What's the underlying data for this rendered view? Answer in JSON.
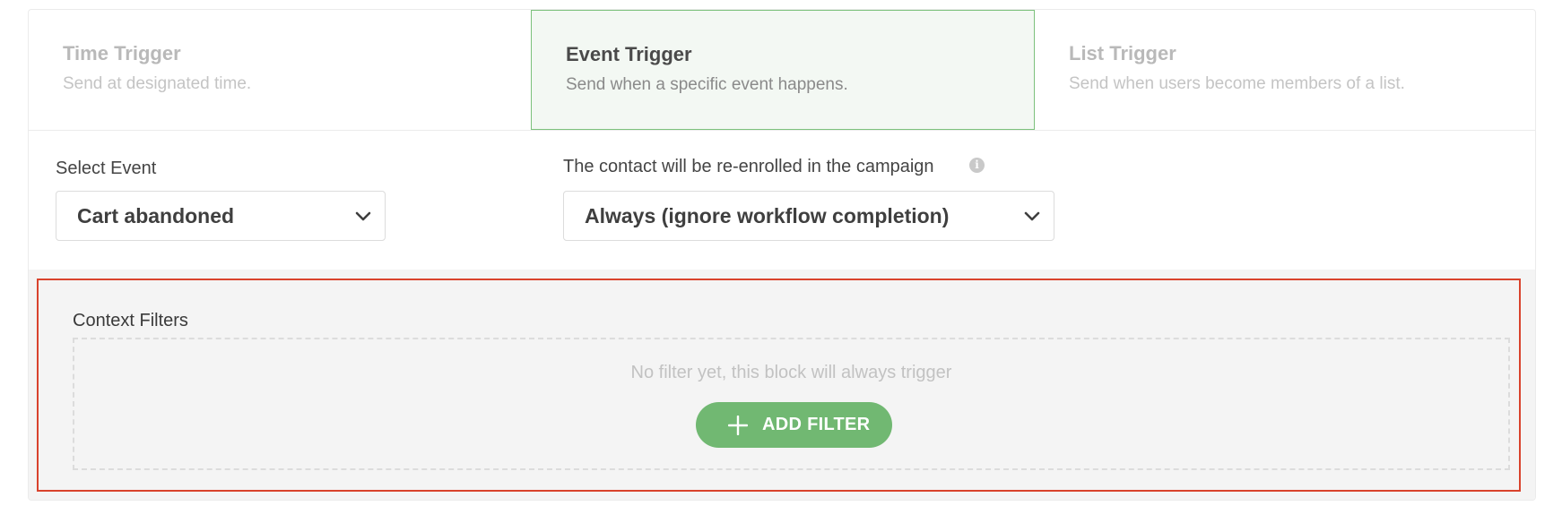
{
  "tabs": [
    {
      "title": "Time Trigger",
      "description": "Send at designated time.",
      "active": false
    },
    {
      "title": "Event Trigger",
      "description": "Send when a specific event happens.",
      "active": true
    },
    {
      "title": "List Trigger",
      "description": "Send when users become members of a list.",
      "active": false
    }
  ],
  "select_event": {
    "label": "Select Event",
    "value": "Cart abandoned",
    "icon": "chevron-down-icon"
  },
  "reenroll": {
    "label": "The contact will be re-enrolled in the campaign",
    "info_icon": "info-icon",
    "value": "Always (ignore workflow completion)",
    "icon": "chevron-down-icon"
  },
  "context_filters": {
    "label": "Context Filters",
    "empty_message": "No filter yet, this block will always trigger",
    "add_button_label": "ADD FILTER",
    "add_icon": "plus-icon"
  },
  "colors": {
    "accent_green": "#71b872",
    "active_tab_bg": "#f3f8f3",
    "active_tab_border": "#7cc17c",
    "highlight_red": "#d9432d"
  }
}
